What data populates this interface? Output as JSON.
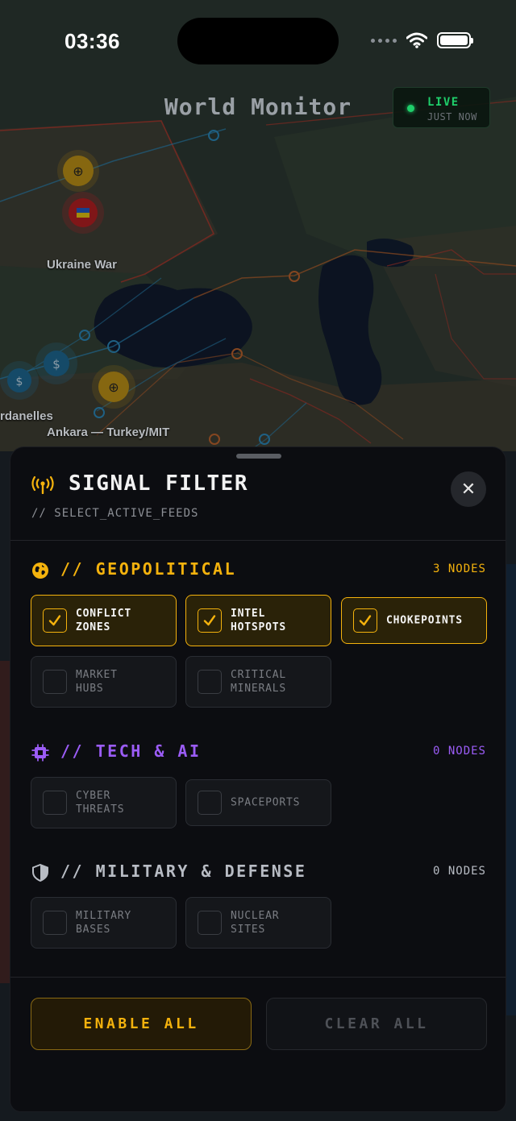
{
  "status_bar": {
    "time": "03:36"
  },
  "header": {
    "title": "World Monitor",
    "live_label": "LIVE",
    "live_time": "JUST NOW"
  },
  "map": {
    "labels": [
      "Ukraine War",
      "rdanelles",
      "Ankara — Turkey/MIT"
    ]
  },
  "sheet": {
    "title": "SIGNAL FILTER",
    "subtitle": "// SELECT_ACTIVE_FEEDS",
    "sections": [
      {
        "title": "// GEOPOLITICAL",
        "count": "3 NODES",
        "color": "#f4b20d",
        "icon": "globe-icon",
        "items": [
          {
            "label": "CONFLICT\nZONES",
            "checked": true
          },
          {
            "label": "INTEL\nHOTSPOTS",
            "checked": true
          },
          {
            "label": "CHOKEPOINTS",
            "checked": true
          },
          {
            "label": "MARKET\nHUBS",
            "checked": false
          },
          {
            "label": "CRITICAL\nMINERALS",
            "checked": false
          }
        ]
      },
      {
        "title": "// TECH & AI",
        "count": "0 NODES",
        "color": "#9b5cf6",
        "icon": "chip-icon",
        "items": [
          {
            "label": "CYBER\nTHREATS",
            "checked": false
          },
          {
            "label": "SPACEPORTS",
            "checked": false
          }
        ]
      },
      {
        "title": "// MILITARY & DEFENSE",
        "count": "0 NODES",
        "color": "#b8bcc4",
        "icon": "shield-icon",
        "items": [
          {
            "label": "MILITARY\nBASES",
            "checked": false
          },
          {
            "label": "NUCLEAR\nSITES",
            "checked": false
          }
        ]
      }
    ],
    "enable_all": "ENABLE ALL",
    "clear_all": "CLEAR ALL"
  }
}
